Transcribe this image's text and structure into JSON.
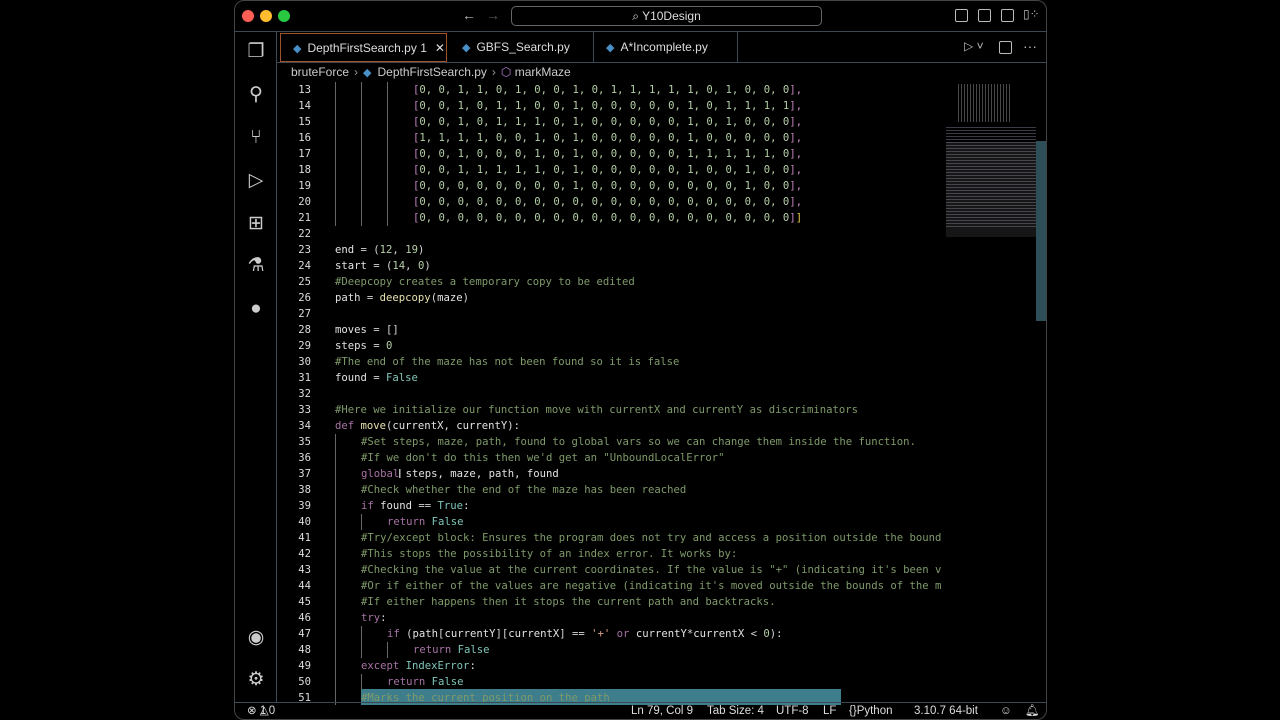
{
  "title": {
    "search": "Y10Design",
    "search_icon": "search-icon"
  },
  "tabs": [
    {
      "label": "DepthFirstSearch.py",
      "badge": "1",
      "active": true
    },
    {
      "label": "GBFS_Search.py"
    },
    {
      "label": "A*Incomplete.py"
    }
  ],
  "breadcrumb": {
    "folder": "bruteForce",
    "file": "DepthFirstSearch.py",
    "symbol": "markMaze"
  },
  "status": {
    "errors": "1",
    "warnings": "0",
    "position": "Ln 79, Col 9",
    "tab_size": "Tab Size: 4",
    "encoding": "UTF-8",
    "eol": "LF",
    "language": "Python",
    "interpreter": "3.10.7 64-bit"
  },
  "colors": {
    "accent_tab_border": "#a0522d",
    "highlight": "#3e7d8c"
  },
  "code": [
    {
      "n": 13,
      "i": 3,
      "t": [
        [
          "[",
          "br"
        ],
        [
          "0, 0, 1, 1, 0, 1, 0, 0, 1, 0, 1, 1, 1, 1, 1, 0, 1, 0, 0, 0",
          "n"
        ],
        [
          "],",
          "br"
        ]
      ]
    },
    {
      "n": 14,
      "i": 3,
      "t": [
        [
          "[",
          "br"
        ],
        [
          "0, 0, 1, 0, 1, 1, 0, 0, 1, 0, 0, 0, 0, 0, 1, 0, 1, 1, 1, 1",
          "n"
        ],
        [
          "],",
          "br"
        ]
      ]
    },
    {
      "n": 15,
      "i": 3,
      "t": [
        [
          "[",
          "br"
        ],
        [
          "0, 0, 1, 0, 1, 1, 1, 0, 1, 0, 0, 0, 0, 0, 1, 0, 1, 0, 0, 0",
          "n"
        ],
        [
          "],",
          "br"
        ]
      ]
    },
    {
      "n": 16,
      "i": 3,
      "t": [
        [
          "[",
          "br"
        ],
        [
          "1, 1, 1, 1, 0, 0, 1, 0, 1, 0, 0, 0, 0, 0, 1, 0, 0, 0, 0, 0",
          "n"
        ],
        [
          "],",
          "br"
        ]
      ]
    },
    {
      "n": 17,
      "i": 3,
      "t": [
        [
          "[",
          "br"
        ],
        [
          "0, 0, 1, 0, 0, 0, 1, 0, 1, 0, 0, 0, 0, 0, 1, 1, 1, 1, 1, 0",
          "n"
        ],
        [
          "],",
          "br"
        ]
      ]
    },
    {
      "n": 18,
      "i": 3,
      "t": [
        [
          "[",
          "br"
        ],
        [
          "0, 0, 1, 1, 1, 1, 1, 0, 1, 0, 0, 0, 0, 0, 1, 0, 0, 1, 0, 0",
          "n"
        ],
        [
          "],",
          "br"
        ]
      ]
    },
    {
      "n": 19,
      "i": 3,
      "t": [
        [
          "[",
          "br"
        ],
        [
          "0, 0, 0, 0, 0, 0, 0, 0, 1, 0, 0, 0, 0, 0, 0, 0, 0, 1, 0, 0",
          "n"
        ],
        [
          "],",
          "br"
        ]
      ]
    },
    {
      "n": 20,
      "i": 3,
      "t": [
        [
          "[",
          "br"
        ],
        [
          "0, 0, 0, 0, 0, 0, 0, 0, 0, 0, 0, 0, 0, 0, 0, 0, 0, 0, 0, 0",
          "n"
        ],
        [
          "],",
          "br"
        ]
      ]
    },
    {
      "n": 21,
      "i": 3,
      "t": [
        [
          "[",
          "br"
        ],
        [
          "0, 0, 0, 0, 0, 0, 0, 0, 0, 0, 0, 0, 0, 0, 0, 0, 0, 0, 0, 0",
          "n"
        ],
        [
          "]",
          "br"
        ],
        [
          "]",
          "by"
        ]
      ]
    },
    {
      "n": 22,
      "i": 0,
      "t": []
    },
    {
      "n": 23,
      "i": 0,
      "t": [
        [
          "end",
          "v"
        ],
        [
          " = (",
          "o"
        ],
        [
          "12",
          "n"
        ],
        [
          ", ",
          "o"
        ],
        [
          "19",
          "n"
        ],
        [
          ")",
          "o"
        ]
      ]
    },
    {
      "n": 24,
      "i": 0,
      "t": [
        [
          "start",
          "v"
        ],
        [
          " = (",
          "o"
        ],
        [
          "14",
          "n"
        ],
        [
          ", ",
          "o"
        ],
        [
          "0",
          "n"
        ],
        [
          ")",
          "o"
        ]
      ]
    },
    {
      "n": 25,
      "i": 0,
      "t": [
        [
          "#Deepcopy creates a temporary copy to be edited",
          "c"
        ]
      ]
    },
    {
      "n": 26,
      "i": 0,
      "t": [
        [
          "path",
          "v"
        ],
        [
          " = ",
          "o"
        ],
        [
          "deepcopy",
          "f"
        ],
        [
          "(",
          "o"
        ],
        [
          "maze",
          "v"
        ],
        [
          ")",
          "o"
        ]
      ]
    },
    {
      "n": 27,
      "i": 0,
      "t": []
    },
    {
      "n": 28,
      "i": 0,
      "t": [
        [
          "moves",
          "v"
        ],
        [
          " = []",
          "o"
        ]
      ]
    },
    {
      "n": 29,
      "i": 0,
      "t": [
        [
          "steps",
          "v"
        ],
        [
          " = ",
          "o"
        ],
        [
          "0",
          "n"
        ]
      ]
    },
    {
      "n": 30,
      "i": 0,
      "t": [
        [
          "#The end of the maze has not been found so it is false",
          "c"
        ]
      ]
    },
    {
      "n": 31,
      "i": 0,
      "t": [
        [
          "found",
          "v"
        ],
        [
          " = ",
          "o"
        ],
        [
          "False",
          "b"
        ]
      ]
    },
    {
      "n": 32,
      "i": 0,
      "t": []
    },
    {
      "n": 33,
      "i": 0,
      "t": [
        [
          "#Here we initialize our function move with currentX and currentY as discriminators",
          "c"
        ]
      ]
    },
    {
      "n": 34,
      "i": 0,
      "t": [
        [
          "def ",
          "k"
        ],
        [
          "move",
          "f"
        ],
        [
          "(",
          "o"
        ],
        [
          "currentX",
          "v"
        ],
        [
          ", ",
          "o"
        ],
        [
          "currentY",
          "v"
        ],
        [
          "):",
          "o"
        ]
      ]
    },
    {
      "n": 35,
      "i": 1,
      "t": [
        [
          "#Set steps, maze, path, found to global vars so we can change them inside the function.",
          "c"
        ]
      ]
    },
    {
      "n": 36,
      "i": 1,
      "t": [
        [
          "#If we don't do this then we'd get an \"UnboundLocalError\"",
          "c"
        ]
      ]
    },
    {
      "n": 37,
      "i": 1,
      "t": [
        [
          "global ",
          "k"
        ],
        [
          "steps, maze, path, found",
          "v"
        ]
      ]
    },
    {
      "n": 38,
      "i": 1,
      "t": [
        [
          "#Check whether the end of the maze has been reached",
          "c"
        ]
      ]
    },
    {
      "n": 39,
      "i": 1,
      "t": [
        [
          "if ",
          "k"
        ],
        [
          "found",
          "v"
        ],
        [
          " == ",
          "o"
        ],
        [
          "True",
          "b"
        ],
        [
          ":",
          "o"
        ]
      ]
    },
    {
      "n": 40,
      "i": 2,
      "t": [
        [
          "return ",
          "k"
        ],
        [
          "False",
          "b"
        ]
      ]
    },
    {
      "n": 41,
      "i": 1,
      "t": [
        [
          "#Try/except block: Ensures the program does not try and access a position outside the bound",
          "c"
        ]
      ]
    },
    {
      "n": 42,
      "i": 1,
      "t": [
        [
          "#This stops the possibility of an index error. It works by:",
          "c"
        ]
      ]
    },
    {
      "n": 43,
      "i": 1,
      "t": [
        [
          "#Checking the value at the current coordinates. If the value is \"+\" (indicating it's been v",
          "c"
        ]
      ]
    },
    {
      "n": 44,
      "i": 1,
      "t": [
        [
          "#Or if either of the values are negative (indicating it's moved outside the bounds of the m",
          "c"
        ]
      ]
    },
    {
      "n": 45,
      "i": 1,
      "t": [
        [
          "#If either happens then it stops the current path and backtracks.",
          "c"
        ]
      ]
    },
    {
      "n": 46,
      "i": 1,
      "t": [
        [
          "try",
          "k"
        ],
        [
          ":",
          "o"
        ]
      ]
    },
    {
      "n": 47,
      "i": 2,
      "t": [
        [
          "if ",
          "k"
        ],
        [
          "(",
          "o"
        ],
        [
          "path",
          "v"
        ],
        [
          "[",
          "o"
        ],
        [
          "currentY",
          "v"
        ],
        [
          "][",
          "o"
        ],
        [
          "currentX",
          "v"
        ],
        [
          "] == ",
          "o"
        ],
        [
          "'+'",
          "s"
        ],
        [
          " or ",
          "k"
        ],
        [
          "currentY",
          "v"
        ],
        [
          "*",
          "o"
        ],
        [
          "currentX",
          "v"
        ],
        [
          " < ",
          "o"
        ],
        [
          "0",
          "n"
        ],
        [
          "):",
          "o"
        ]
      ]
    },
    {
      "n": 48,
      "i": 3,
      "t": [
        [
          "return ",
          "k"
        ],
        [
          "False",
          "b"
        ]
      ]
    },
    {
      "n": 49,
      "i": 1,
      "t": [
        [
          "except ",
          "k"
        ],
        [
          "IndexError",
          "b"
        ],
        [
          ":",
          "o"
        ]
      ]
    },
    {
      "n": 50,
      "i": 2,
      "t": [
        [
          "return ",
          "k"
        ],
        [
          "False",
          "b"
        ]
      ]
    },
    {
      "n": 51,
      "i": 1,
      "t": [
        [
          "#Marks the current position on the path",
          "c"
        ]
      ]
    }
  ]
}
